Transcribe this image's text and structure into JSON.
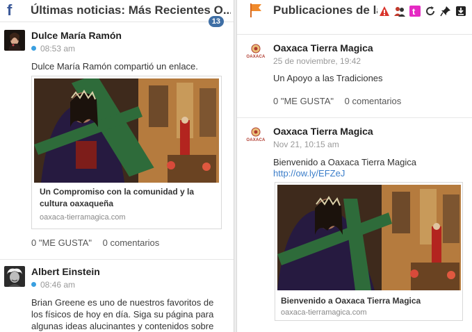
{
  "left_column": {
    "icon": "facebook-icon",
    "title": "Últimas noticias: Más Recientes O...",
    "badge": "13",
    "posts": [
      {
        "author": "Dulce María Ramón",
        "time": "08:53 am",
        "text": "Dulce María Ramón compartió un enlace.",
        "card_title": "Un Compromiso con la comunidad y la cultura oaxaqueña",
        "card_domain": "oaxaca-tierramagica.com",
        "likes": "0 \"ME GUSTA\"",
        "comments": "0 comentarios"
      },
      {
        "author": "Albert Einstein",
        "time": "08:46 am",
        "text": "Brian Greene es uno de nuestros favoritos de los físicos de hoy en día. Siga su página para algunas ideas alucinantes y contenidos sobre"
      }
    ]
  },
  "right_column": {
    "icon": "flag-icon",
    "title": "Publicaciones de la página",
    "toolbar": [
      "warning-icon",
      "people-icon",
      "tumblr-icon",
      "refresh-icon",
      "pin-icon",
      "download-icon"
    ],
    "posts": [
      {
        "author": "Oaxaca Tierra Magica",
        "logo_text": "OAXACA",
        "time": "25 de noviembre, 19:42",
        "text": "Un Apoyo a las Tradiciones",
        "likes": "0 \"ME GUSTA\"",
        "comments": "0 comentarios"
      },
      {
        "author": "Oaxaca Tierra Magica",
        "logo_text": "OAXACA",
        "time": "Nov 21, 10:15 am",
        "text": "Bienvenido a Oaxaca Tierra Magica",
        "link": "http://ow.ly/EFZeJ",
        "card_title": "Bienvenido a Oaxaca Tierra Magica",
        "card_domain": "oaxaca-tierramagica.com"
      }
    ]
  }
}
